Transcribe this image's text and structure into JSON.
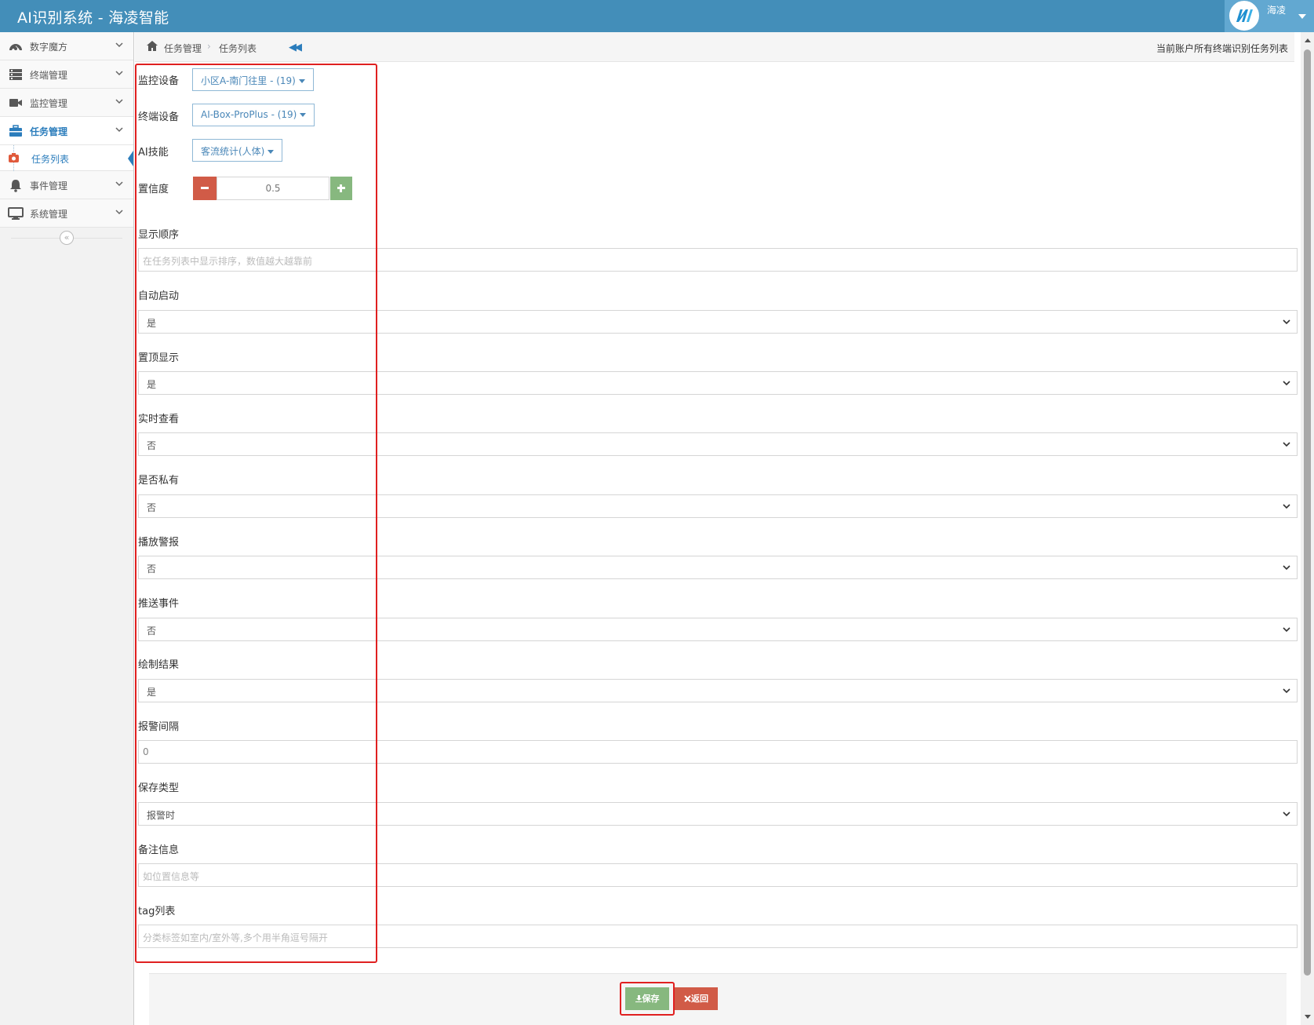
{
  "app": {
    "title": "AI识别系统 - 海凌智能"
  },
  "user": {
    "name": "海凌"
  },
  "sidebar": {
    "items": [
      {
        "label": "数字魔方",
        "icon": "dashboard-icon"
      },
      {
        "label": "终端管理",
        "icon": "server-icon"
      },
      {
        "label": "监控管理",
        "icon": "video-camera-icon"
      },
      {
        "label": "任务管理",
        "icon": "briefcase-icon",
        "active": true
      },
      {
        "label": "事件管理",
        "icon": "bell-icon"
      },
      {
        "label": "系统管理",
        "icon": "desktop-icon"
      }
    ],
    "sub_item": {
      "label": "任务列表",
      "icon": "camera-icon"
    },
    "collapse_glyph": "«"
  },
  "breadcrumb": {
    "items": [
      "任务管理",
      "任务列表"
    ],
    "separator": "›",
    "back_glyph": "◀◀",
    "right_text": "当前账户所有终端识别任务列表"
  },
  "form": {
    "monitor_device": {
      "label": "监控设备",
      "value": "小区A-南门往里 - (19)"
    },
    "terminal_device": {
      "label": "终端设备",
      "value": "AI-Box-ProPlus - (19)"
    },
    "ai_skill": {
      "label": "AI技能",
      "value": "客流统计(人体)"
    },
    "confidence": {
      "label": "置信度",
      "value": "0.5"
    },
    "display_order": {
      "label": "显示顺序",
      "placeholder": "在任务列表中显示排序，数值越大越靠前"
    },
    "auto_start": {
      "label": "自动启动",
      "value": "是"
    },
    "pin_top": {
      "label": "置顶显示",
      "value": "是"
    },
    "realtime_view": {
      "label": "实时查看",
      "value": "否"
    },
    "is_private": {
      "label": "是否私有",
      "value": "否"
    },
    "play_alarm": {
      "label": "播放警报",
      "value": "否"
    },
    "push_event": {
      "label": "推送事件",
      "value": "否"
    },
    "draw_result": {
      "label": "绘制结果",
      "value": "是"
    },
    "alarm_interval": {
      "label": "报警间隔",
      "value": "0"
    },
    "save_type": {
      "label": "保存类型",
      "value": "报警时"
    },
    "remark": {
      "label": "备注信息",
      "placeholder": "如位置信息等"
    },
    "tags": {
      "label": "tag列表",
      "placeholder": "分类标签如室内/室外等,多个用半角逗号隔开"
    }
  },
  "actions": {
    "save_label": "保存",
    "back_label": "返回"
  },
  "colors": {
    "navbar": "#438eb9",
    "accent": "#2b7dbc",
    "save": "#87b87f",
    "danger": "#d15b47",
    "highlight": "#e02020"
  }
}
